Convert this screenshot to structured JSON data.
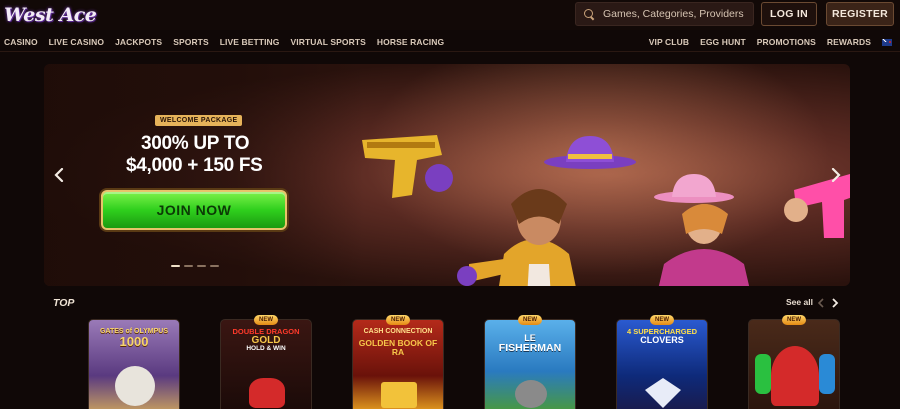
{
  "header": {
    "logo_text": "West Ace",
    "search_placeholder": "Games, Categories, Providers",
    "login_label": "LOG IN",
    "register_label": "REGISTER"
  },
  "nav": {
    "left_items": [
      "CASINO",
      "LIVE CASINO",
      "JACKPOTS",
      "SPORTS",
      "LIVE BETTING",
      "VIRTUAL SPORTS",
      "HORSE RACING"
    ],
    "right_items": [
      "VIP CLUB",
      "EGG HUNT",
      "PROMOTIONS",
      "REWARDS"
    ],
    "flag_icon": "new-zealand-flag-icon"
  },
  "banner": {
    "badge": "WELCOME PACKAGE",
    "headline_line1": "300% UP TO",
    "headline_line2": "$4,000 + 150 FS",
    "cta_label": "JOIN NOW",
    "slide_count": 4,
    "active_slide": 1,
    "accent_color": "#2fcf1d"
  },
  "top_section": {
    "title": "TOP",
    "see_all_label": "See all",
    "new_badge_label": "NEW",
    "games": [
      {
        "title_line1": "GATES of OLYMPUS",
        "title_line2": "1000",
        "is_new": false,
        "bg": "#6b4a8a"
      },
      {
        "title_line1": "DOUBLE DRAGON",
        "title_line2": "GOLD",
        "subtitle": "HOLD & WIN",
        "is_new": true,
        "bg": "#2a1414"
      },
      {
        "title_line1": "CASH CONNECTION",
        "title_line2": "GOLDEN BOOK OF RA",
        "is_new": true,
        "bg": "#8a1c12"
      },
      {
        "title_line1": "LE",
        "title_line2": "FISHERMAN",
        "is_new": true,
        "bg": "#3b8ed0"
      },
      {
        "title_line1": "4 SUPERCHARGED",
        "title_line2": "CLOVERS",
        "is_new": true,
        "bg": "#1c3a9a"
      },
      {
        "title_line1": "",
        "title_line2": "",
        "is_new": true,
        "bg": "#3a1a12"
      }
    ]
  }
}
